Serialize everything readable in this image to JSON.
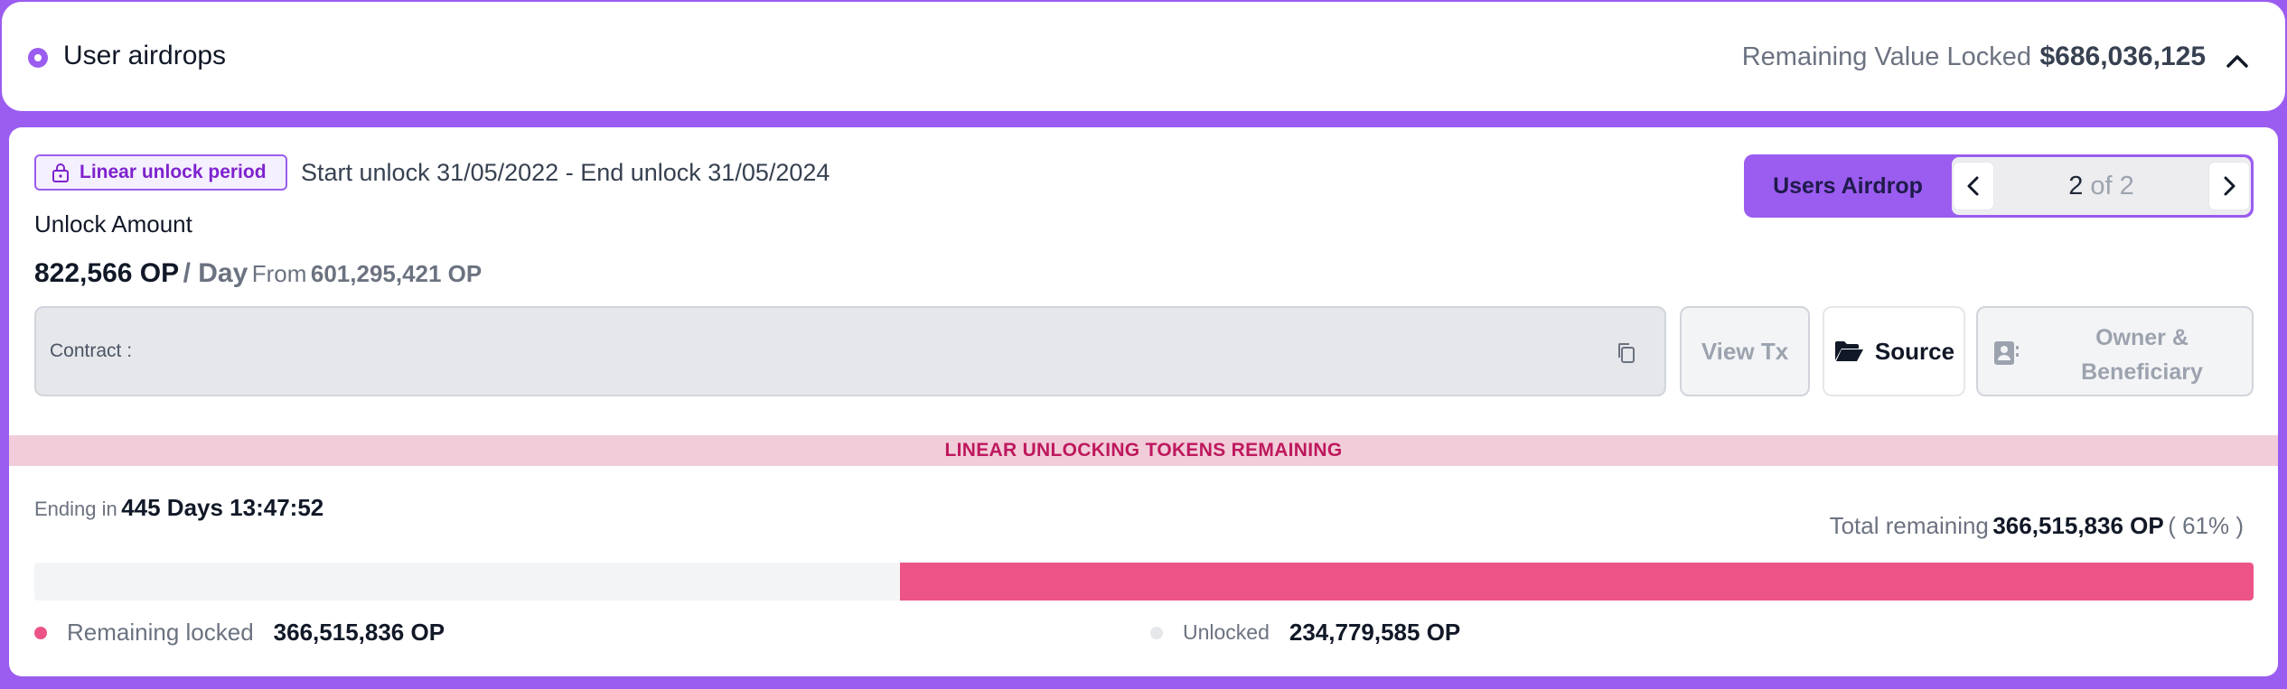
{
  "header": {
    "title": "User airdrops",
    "remaining_value_locked_label": "Remaining Value Locked",
    "remaining_value_locked_value": "$686,036,125",
    "collapse_icon": "chevron-up-icon"
  },
  "schedule": {
    "badge_label": "Linear unlock period",
    "badge_icon": "lock-icon",
    "unlock_dates": "Start unlock 31/05/2022 - End unlock 31/05/2024"
  },
  "unlock": {
    "label": "Unlock Amount",
    "amount": "822,566 OP",
    "per": "/ Day",
    "from_label": "From",
    "from_value": "601,295,421 OP"
  },
  "airdrop_nav": {
    "label": "Users Airdrop",
    "current": "2",
    "of_total": "of 2"
  },
  "contract": {
    "label": "Contract :",
    "value": ""
  },
  "actions": {
    "view_tx": "View Tx",
    "source": "Source",
    "owner_line1": "Owner &",
    "owner_line2": "Beneficiary"
  },
  "progress_section": {
    "strip_title": "LINEAR UNLOCKING TOKENS REMAINING",
    "ending_label": "Ending in",
    "ending_value": "445 Days 13:47:52",
    "total_remaining_label": "Total remaining",
    "total_remaining_value": "366,515,836 OP",
    "total_remaining_percent": "( 61% )",
    "remaining_fraction": 0.61,
    "remaining_locked_label": "Remaining locked",
    "remaining_locked_value": "366,515,836 OP",
    "unlocked_label": "Unlocked",
    "unlocked_value": "234,779,585 OP"
  },
  "colors": {
    "accent": "#9b5cf0",
    "locked": "#ec5387",
    "unlocked": "#f3f4f6",
    "strip_bg": "#f1cdd9",
    "strip_text": "#be185d"
  }
}
